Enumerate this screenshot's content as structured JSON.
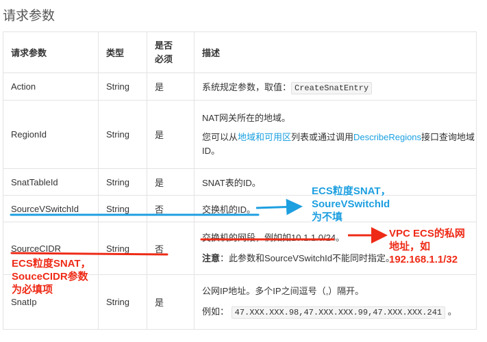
{
  "section_title": "请求参数",
  "table": {
    "headers": [
      "请求参数",
      "类型",
      "是否必须",
      "描述"
    ],
    "rows": [
      {
        "name": "Action",
        "type": "String",
        "required": "是",
        "desc_prefix": "系统规定参数，取值：",
        "desc_code": "CreateSnatEntry"
      },
      {
        "name": "RegionId",
        "type": "String",
        "required": "是",
        "desc_line1": "NAT网关所在的地域。",
        "desc_line2_a": "您可以从",
        "desc_link1": "地域和可用区",
        "desc_line2_b": "列表或通过调用",
        "desc_link2": "DescribeRegions",
        "desc_line2_c": "接口查询地域ID。"
      },
      {
        "name": "SnatTableId",
        "type": "String",
        "required": "是",
        "desc": "SNAT表的ID。"
      },
      {
        "name": "SourceVSwitchId",
        "type": "String",
        "required": "否",
        "desc": "交换机的ID。"
      },
      {
        "name": "SourceCIDR",
        "type": "String",
        "required": "否",
        "desc_line1": "交换机的网段，例如如10.1.1.0/24。",
        "desc_note_label": "注意",
        "desc_note_text": "：此参数和SourceVSwitchId不能同时指定。"
      },
      {
        "name": "SnatIp",
        "type": "String",
        "required": "是",
        "desc_line1": "公网IP地址。多个IP之间逗号（,）隔开。",
        "desc_example_label": "例如：",
        "desc_code": "47.XXX.XXX.98,47.XXX.XXX.99,47.XXX.XXX.241",
        "desc_suffix": "。"
      }
    ]
  },
  "annotations": {
    "blue_note": [
      "ECS粒度SNAT，",
      "SoureVSwitchId",
      "为不填"
    ],
    "red_note_right": [
      "VPC ECS的私网",
      "地址，如",
      "192.168.1.1/32"
    ],
    "red_note_left": [
      "ECS粒度SNAT，",
      "SouceCIDR参数",
      "为必填项"
    ],
    "colors": {
      "blue": "#1d9fe0",
      "red": "#ee2a16",
      "link": "#1aa0e0"
    }
  }
}
